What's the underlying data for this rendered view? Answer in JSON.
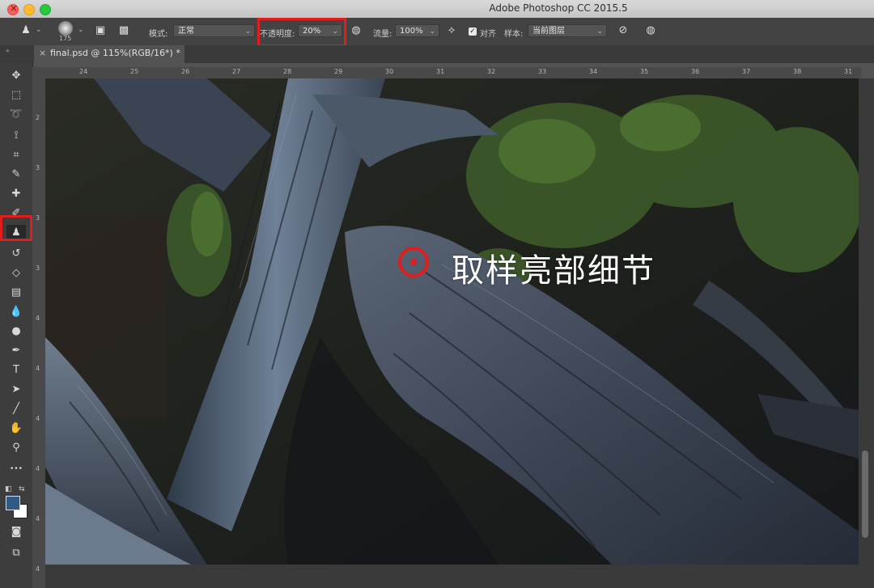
{
  "window": {
    "title": "Adobe Photoshop CC 2015.5"
  },
  "options_bar": {
    "brush_size": "175",
    "mode_label": "模式:",
    "mode_value": "正常",
    "opacity_label": "不透明度:",
    "opacity_value": "20%",
    "flow_label": "流量:",
    "flow_value": "100%",
    "aligned_label": "对齐",
    "aligned_checked": "✓",
    "sample_label": "样本:",
    "sample_value": "当前图层",
    "dropdown_glyph": "⌄",
    "highlight_color": "#e01e1e"
  },
  "tabs": {
    "collapse": "»",
    "close": "×",
    "document": "final.psd @ 115%(RGB/16*) *"
  },
  "rulers": {
    "horizontal": [
      "24",
      "25",
      "26",
      "27",
      "28",
      "29",
      "30",
      "31",
      "32",
      "33",
      "34",
      "35",
      "36",
      "37",
      "38",
      "31"
    ],
    "vertical": [
      "2",
      "3",
      "3",
      "3",
      "4",
      "4",
      "4",
      "4",
      "4",
      "4"
    ]
  },
  "tools": [
    {
      "name": "move-tool",
      "glyph": "✥"
    },
    {
      "name": "marquee-tool",
      "glyph": "⬚"
    },
    {
      "name": "lasso-tool",
      "glyph": "➰"
    },
    {
      "name": "quick-selection-tool",
      "glyph": "⟟"
    },
    {
      "name": "crop-tool",
      "glyph": "⌗"
    },
    {
      "name": "eyedropper-tool",
      "glyph": "✎"
    },
    {
      "name": "healing-brush-tool",
      "glyph": "✚"
    },
    {
      "name": "brush-tool",
      "glyph": "✐"
    },
    {
      "name": "clone-stamp-tool",
      "glyph": "♟"
    },
    {
      "name": "history-brush-tool",
      "glyph": "↺"
    },
    {
      "name": "eraser-tool",
      "glyph": "◇"
    },
    {
      "name": "gradient-tool",
      "glyph": "▤"
    },
    {
      "name": "blur-tool",
      "glyph": "💧"
    },
    {
      "name": "dodge-tool",
      "glyph": "●"
    },
    {
      "name": "pen-tool",
      "glyph": "✒"
    },
    {
      "name": "type-tool",
      "glyph": "T"
    },
    {
      "name": "path-selection-tool",
      "glyph": "➤"
    },
    {
      "name": "line-tool",
      "glyph": "╱"
    },
    {
      "name": "hand-tool",
      "glyph": "✋"
    },
    {
      "name": "zoom-tool",
      "glyph": "⚲"
    },
    {
      "name": "more-tools",
      "glyph": "•••"
    }
  ],
  "colors": {
    "foreground": "#2f5a86",
    "background": "#ffffff"
  },
  "annotation": {
    "text": "取样亮部细节",
    "color": "#e01e1e"
  }
}
